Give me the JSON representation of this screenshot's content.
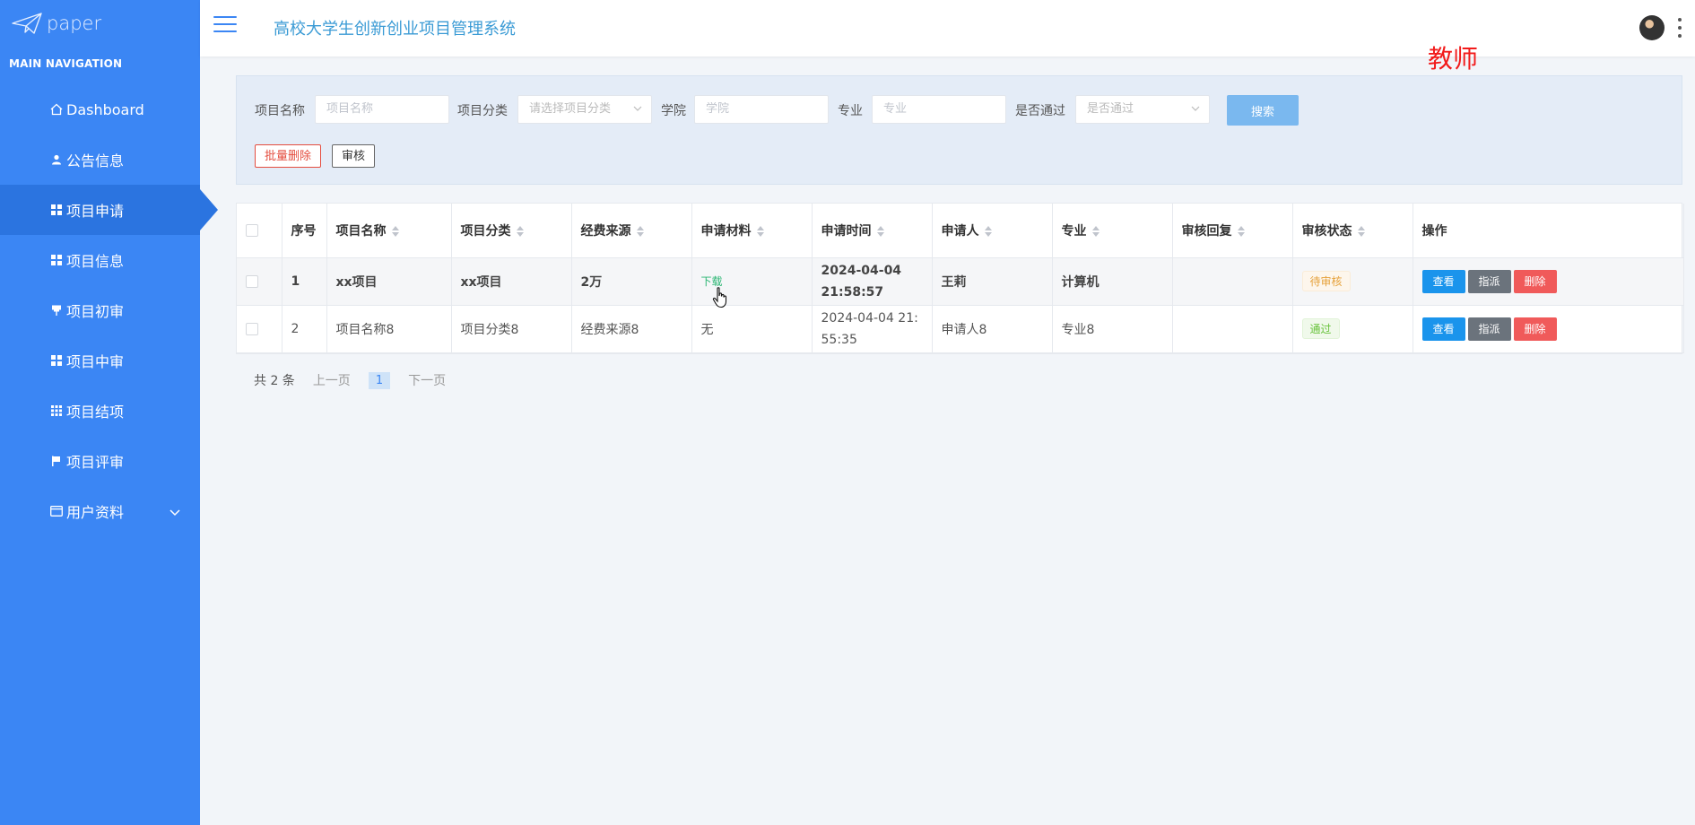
{
  "logo": {
    "text": "paper"
  },
  "sidebar": {
    "heading": "MAIN NAVIGATION",
    "items": [
      {
        "label": "Dashboard",
        "icon": "home-icon"
      },
      {
        "label": "公告信息",
        "icon": "user-icon"
      },
      {
        "label": "项目申请",
        "icon": "grid-icon",
        "active": true
      },
      {
        "label": "项目信息",
        "icon": "grid-icon"
      },
      {
        "label": "项目初审",
        "icon": "pin-icon"
      },
      {
        "label": "项目中审",
        "icon": "grid-icon"
      },
      {
        "label": "项目结项",
        "icon": "table-icon"
      },
      {
        "label": "项目评审",
        "icon": "flag-icon"
      },
      {
        "label": "用户资料",
        "icon": "card-icon",
        "expandable": true
      }
    ]
  },
  "header": {
    "title": "高校大学生创新创业项目管理系统",
    "role": "教师"
  },
  "search": {
    "name_label": "项目名称",
    "name_placeholder": "项目名称",
    "category_label": "项目分类",
    "category_placeholder": "请选择项目分类",
    "college_label": "学院",
    "college_placeholder": "学院",
    "major_label": "专业",
    "major_placeholder": "专业",
    "pass_label": "是否通过",
    "pass_placeholder": "是否通过",
    "search_button": "搜索",
    "batch_delete_button": "批量删除",
    "audit_button": "审核"
  },
  "table": {
    "columns": [
      "序号",
      "项目名称",
      "项目分类",
      "经费来源",
      "申请材料",
      "申请时间",
      "申请人",
      "专业",
      "审核回复",
      "审核状态",
      "操作"
    ],
    "rows": [
      {
        "index": "1",
        "name": "xx项目",
        "category": "xx项目",
        "funding": "2万",
        "material": "下载",
        "time": "2024-04-04 21:58:57",
        "applicant": "王莉",
        "major": "计算机",
        "reply": "",
        "status": "待审核"
      },
      {
        "index": "2",
        "name": "项目名称8",
        "category": "项目分类8",
        "funding": "经费来源8",
        "material": "无",
        "time": "2024-04-04 21:55:35",
        "applicant": "申请人8",
        "major": "专业8",
        "reply": "",
        "status": "通过"
      }
    ],
    "actions": {
      "view": "查看",
      "assign": "指派",
      "delete": "删除"
    }
  },
  "pagination": {
    "total": "共 2 条",
    "prev": "上一页",
    "current": "1",
    "next": "下一页"
  },
  "colors": {
    "sidebar": "#3b86f4",
    "accent_title": "#3b9bd5",
    "role": "#f21b1b",
    "view": "#1a94ec",
    "assign": "#6b737c",
    "delete": "#f05a5a"
  }
}
